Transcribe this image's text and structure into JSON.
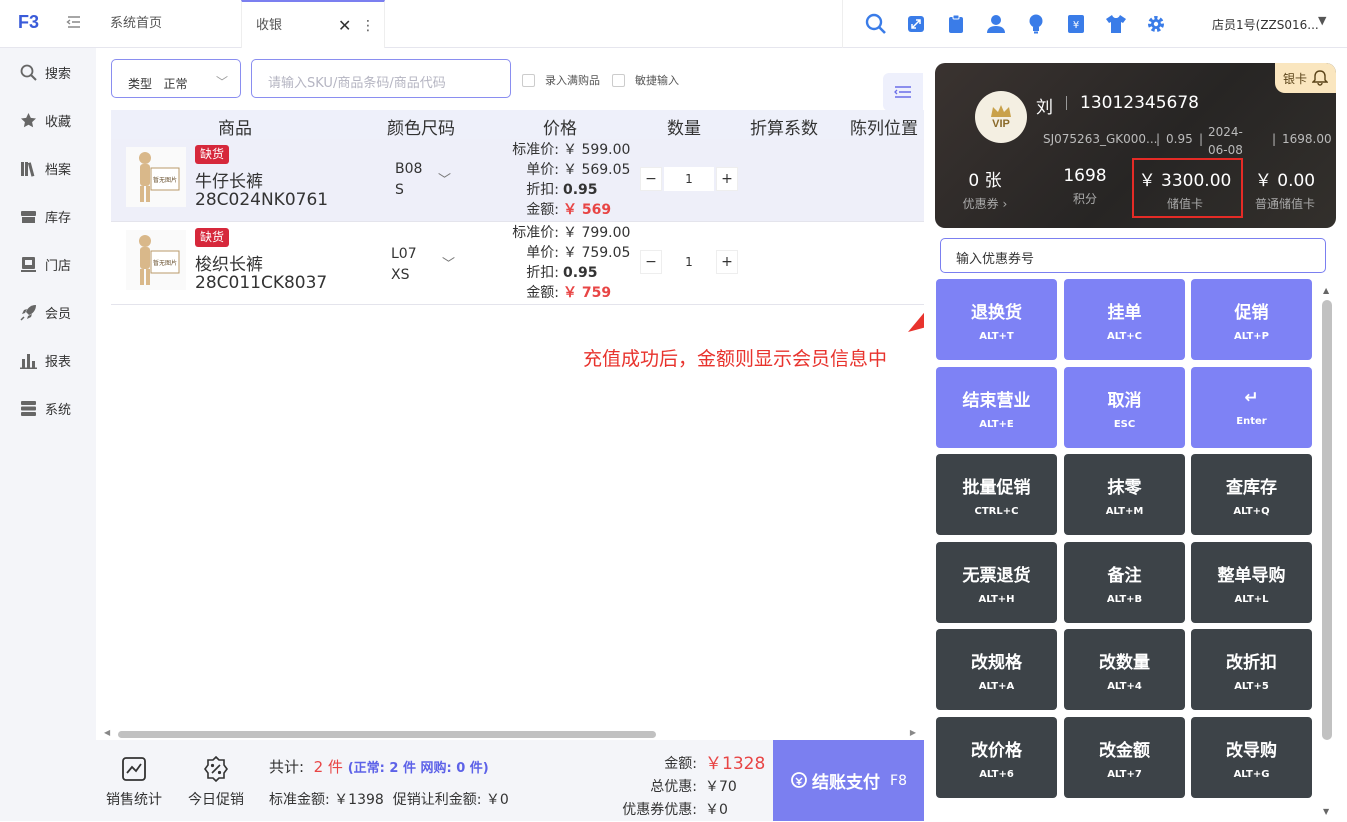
{
  "tabs": [
    {
      "label": "系统首页"
    },
    {
      "label": "收银"
    }
  ],
  "user": {
    "name": "店员1号(ZZS016..."
  },
  "sidebar": {
    "items": [
      {
        "label": "搜索",
        "icon": "search-icon"
      },
      {
        "label": "收藏",
        "icon": "star-icon"
      },
      {
        "label": "档案",
        "icon": "books-icon"
      },
      {
        "label": "库存",
        "icon": "box-icon"
      },
      {
        "label": "门店",
        "icon": "store-icon"
      },
      {
        "label": "会员",
        "icon": "rocket-icon"
      },
      {
        "label": "报表",
        "icon": "bar-chart-icon"
      },
      {
        "label": "系统",
        "icon": "server-icon"
      }
    ]
  },
  "toolbar": {
    "type_label": "类型",
    "type_value": "正常",
    "sku_placeholder": "请输入SKU/商品条码/商品代码",
    "chk_full_gift": "录入满购品",
    "chk_quick": "敏捷输入"
  },
  "table": {
    "headers": [
      "商品",
      "颜色尺码",
      "价格",
      "数量",
      "折算系数",
      "陈列位置"
    ],
    "rows": [
      {
        "badge": "缺货",
        "name": "牛仔长裤",
        "code": "28C024NK0761",
        "color": "B08",
        "size": "S",
        "price_labels": [
          "标准价:",
          "单价:",
          "折扣:",
          "金额:"
        ],
        "std_price": "￥ 599.00",
        "unit_price": "￥ 569.05",
        "discount": "0.95",
        "amount": "￥ 569",
        "qty": "1",
        "thumb_text": "暂无图片"
      },
      {
        "badge": "缺货",
        "name": "梭织长裤",
        "code": "28C011CK8037",
        "color": "L07",
        "size": "XS",
        "price_labels": [
          "标准价:",
          "单价:",
          "折扣:",
          "金额:"
        ],
        "std_price": "￥ 799.00",
        "unit_price": "￥ 759.05",
        "discount": "0.95",
        "amount": "￥ 759",
        "qty": "1",
        "thumb_text": "暂无图片"
      }
    ]
  },
  "annotation": "充值成功后，金额则显示会员信息中",
  "footer": {
    "sales_stats": "销售统计",
    "today_promo": "今日促销",
    "total_label": "共计:",
    "total_count": "2 件",
    "total_detail": "(正常: 2 件  网购: 0 件)",
    "std_amount": "标准金额: ￥1398",
    "promo_amount": "促销让利金额: ￥0",
    "amount_label": "金额:",
    "amount_value": "￥1328",
    "discount_label": "总优惠:",
    "discount_value": "￥70",
    "coupon_label": "优惠券优惠:",
    "coupon_value": "￥0",
    "pay_label": "结账支付",
    "pay_key": "F8"
  },
  "member": {
    "vip": "VIP",
    "name": "刘",
    "phone": "13012345678",
    "card_no": "SJ075263_GK000...",
    "rate": "0.95",
    "date": "2024-06-08",
    "points_meta": "1698.00",
    "card_type": "银卡",
    "coupons": "0 张",
    "coupons_label": "优惠券",
    "points": "1698",
    "points_label": "积分",
    "stored": "￥ 3300.00",
    "stored_label": "储值卡",
    "normal_stored": "￥ 0.00",
    "normal_stored_label": "普通储值卡"
  },
  "coupon_input_placeholder": "输入优惠券号",
  "keys": [
    {
      "label": "退换货",
      "shortcut": "ALT+T",
      "style": "p"
    },
    {
      "label": "挂单",
      "shortcut": "ALT+C",
      "style": "p"
    },
    {
      "label": "促销",
      "shortcut": "ALT+P",
      "style": "p"
    },
    {
      "label": "结束营业",
      "shortcut": "ALT+E",
      "style": "p"
    },
    {
      "label": "取消",
      "shortcut": "ESC",
      "style": "p"
    },
    {
      "label": "↵",
      "shortcut": "Enter",
      "style": "p"
    },
    {
      "label": "批量促销",
      "shortcut": "CTRL+C",
      "style": "d"
    },
    {
      "label": "抹零",
      "shortcut": "ALT+M",
      "style": "d"
    },
    {
      "label": "查库存",
      "shortcut": "ALT+Q",
      "style": "d"
    },
    {
      "label": "无票退货",
      "shortcut": "ALT+H",
      "style": "d"
    },
    {
      "label": "备注",
      "shortcut": "ALT+B",
      "style": "d"
    },
    {
      "label": "整单导购",
      "shortcut": "ALT+L",
      "style": "d"
    },
    {
      "label": "改规格",
      "shortcut": "ALT+A",
      "style": "d"
    },
    {
      "label": "改数量",
      "shortcut": "ALT+4",
      "style": "d"
    },
    {
      "label": "改折扣",
      "shortcut": "ALT+5",
      "style": "d"
    },
    {
      "label": "改价格",
      "shortcut": "ALT+6",
      "style": "d"
    },
    {
      "label": "改金额",
      "shortcut": "ALT+7",
      "style": "d"
    },
    {
      "label": "改导购",
      "shortcut": "ALT+G",
      "style": "d"
    }
  ]
}
